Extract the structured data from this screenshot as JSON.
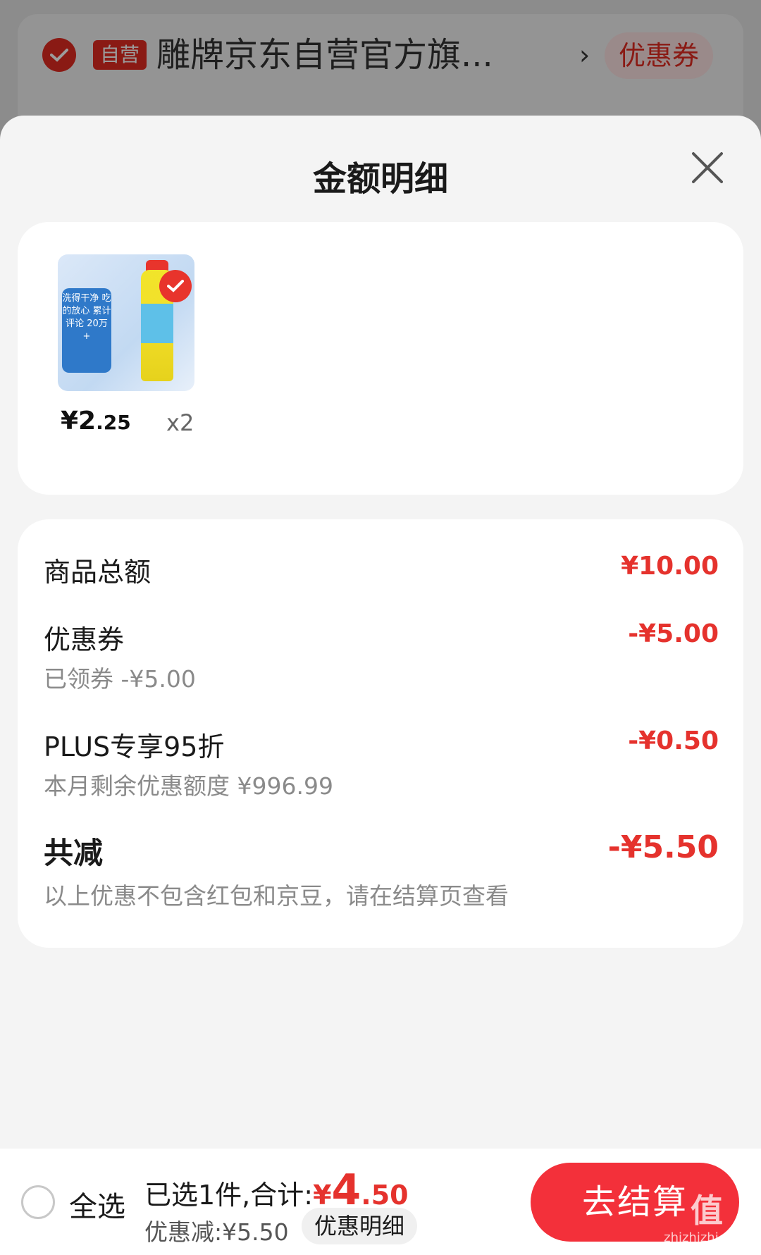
{
  "background": {
    "tag_label": "自营",
    "store_name": "雕牌京东自营官方旗...",
    "arrow": "›",
    "coupon_button": "优惠券"
  },
  "sheet": {
    "title": "金额明细"
  },
  "product": {
    "image_badge": "洗得干净 吃的放心 累计评论 20万+",
    "price_int": "¥2",
    "price_dec": ".25",
    "quantity": "x2"
  },
  "details": {
    "goods_total_label": "商品总额",
    "goods_total_value": "¥10.00",
    "coupon_label": "优惠券",
    "coupon_sub": "已领券 -¥5.00",
    "coupon_value": "-¥5.00",
    "plus_label": "PLUS专享95折",
    "plus_sub": "本月剩余优惠额度 ¥996.99",
    "plus_value": "-¥0.50",
    "total_off_label": "共减",
    "total_off_value": "-¥5.50",
    "note": "以上优惠不包含红包和京豆，请在结算页查看"
  },
  "bottom_bar": {
    "select_all_label": "全选",
    "summary_prefix": "已选1件,合计:",
    "total_symbol": "¥",
    "total_int": "4",
    "total_dec": ".50",
    "discount_text": "优惠减:¥5.50",
    "detail_button": "优惠明细",
    "checkout_button": "去结算"
  },
  "watermark": {
    "text": "值",
    "site": "zhizhizhi.com"
  },
  "colors": {
    "accent_red": "#e5322d",
    "checkout_red": "#f3303a"
  }
}
